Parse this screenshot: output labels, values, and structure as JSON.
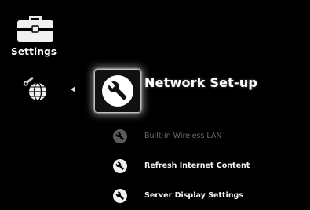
{
  "category": {
    "label": "Settings",
    "icon": "toolbox-icon"
  },
  "side_icon": "globe-network-icon",
  "selected": {
    "title": "Network Set-up",
    "icon": "wrench-icon"
  },
  "items": [
    {
      "label": "Built-in Wireless LAN",
      "icon": "wrench-icon",
      "enabled": false
    },
    {
      "label": "Refresh Internet Content",
      "icon": "wrench-icon",
      "enabled": true
    },
    {
      "label": "Server Display Settings",
      "icon": "wrench-icon",
      "enabled": true
    }
  ],
  "colors": {
    "background": "#000000",
    "text": "#ffffff",
    "disabled_text": "#6a6a6a"
  }
}
